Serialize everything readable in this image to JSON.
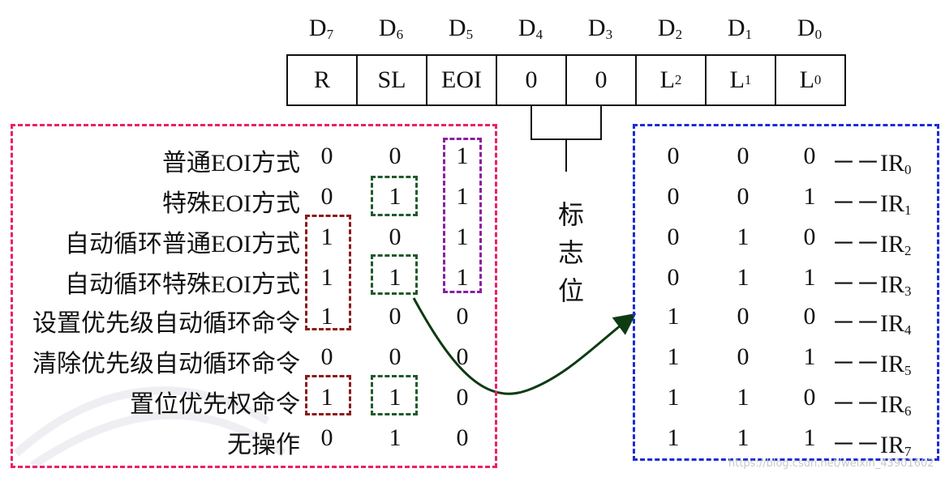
{
  "header": {
    "bits": [
      {
        "base": "D",
        "sub": "7"
      },
      {
        "base": "D",
        "sub": "6"
      },
      {
        "base": "D",
        "sub": "5"
      },
      {
        "base": "D",
        "sub": "4"
      },
      {
        "base": "D",
        "sub": "3"
      },
      {
        "base": "D",
        "sub": "2"
      },
      {
        "base": "D",
        "sub": "1"
      },
      {
        "base": "D",
        "sub": "0"
      }
    ]
  },
  "register": {
    "fields": [
      {
        "base": "R",
        "sub": ""
      },
      {
        "base": "SL",
        "sub": ""
      },
      {
        "base": "EOI",
        "sub": ""
      },
      {
        "base": "0",
        "sub": ""
      },
      {
        "base": "0",
        "sub": ""
      },
      {
        "base": "L",
        "sub": "2"
      },
      {
        "base": "L",
        "sub": "1"
      },
      {
        "base": "L",
        "sub": "0"
      }
    ]
  },
  "flag": {
    "chars": [
      "标",
      "志",
      "位"
    ]
  },
  "commands": {
    "rows": [
      {
        "label": "普通EOI方式",
        "r": "0",
        "sl": "0",
        "eoi": "1"
      },
      {
        "label": "特殊EOI方式",
        "r": "0",
        "sl": "1",
        "eoi": "1"
      },
      {
        "label": "自动循环普通EOI方式",
        "r": "1",
        "sl": "0",
        "eoi": "1"
      },
      {
        "label": "自动循环特殊EOI方式",
        "r": "1",
        "sl": "1",
        "eoi": "1"
      },
      {
        "label": "设置优先级自动循环命令",
        "r": "1",
        "sl": "0",
        "eoi": "0"
      },
      {
        "label": "清除优先级自动循环命令",
        "r": "0",
        "sl": "0",
        "eoi": "0"
      },
      {
        "label": "置位优先权命令",
        "r": "1",
        "sl": "1",
        "eoi": "0"
      },
      {
        "label": "无操作",
        "r": "0",
        "sl": "1",
        "eoi": "0"
      }
    ]
  },
  "levels": {
    "dash": "－－",
    "rows": [
      {
        "l2": "0",
        "l1": "0",
        "l0": "0",
        "ir": "IR",
        "sub": "0"
      },
      {
        "l2": "0",
        "l1": "0",
        "l0": "1",
        "ir": "IR",
        "sub": "1"
      },
      {
        "l2": "0",
        "l1": "1",
        "l0": "0",
        "ir": "IR",
        "sub": "2"
      },
      {
        "l2": "0",
        "l1": "1",
        "l0": "1",
        "ir": "IR",
        "sub": "3"
      },
      {
        "l2": "1",
        "l1": "0",
        "l0": "0",
        "ir": "IR",
        "sub": "4"
      },
      {
        "l2": "1",
        "l1": "0",
        "l0": "1",
        "ir": "IR",
        "sub": "5"
      },
      {
        "l2": "1",
        "l1": "1",
        "l0": "0",
        "ir": "IR",
        "sub": "6"
      },
      {
        "l2": "1",
        "l1": "1",
        "l0": "1",
        "ir": "IR",
        "sub": "7"
      }
    ]
  },
  "colors": {
    "pink": "#e8206b",
    "blue": "#1c2bd6",
    "darkred": "#8b1a1a",
    "green": "#1f5a2a",
    "purple": "#8a1fa0",
    "arrow": "#0d3b12"
  },
  "watermark": "https://blog.csdn.net/weixin_43901602"
}
